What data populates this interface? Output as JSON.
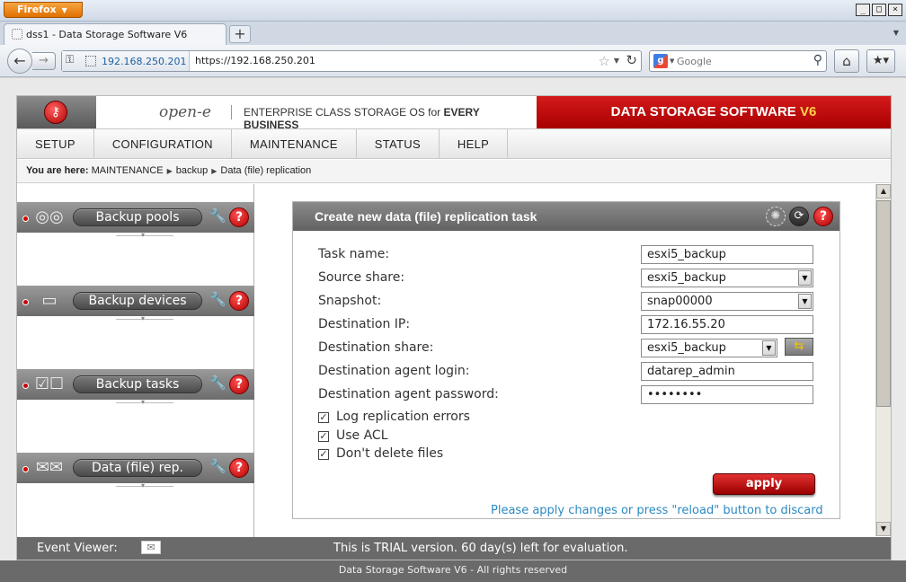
{
  "browser": {
    "app_button": "Firefox",
    "tab_title": "dss1 - Data Storage Software V6",
    "site_identity": "192.168.250.201",
    "url": "https://192.168.250.201",
    "search_placeholder": "Google"
  },
  "header": {
    "logo": "open-e",
    "tagline_pre": "ENTERPRISE CLASS STORAGE OS for ",
    "tagline_bold": "EVERY BUSINESS",
    "product": "DATA STORAGE SOFTWARE ",
    "product_version": "V6"
  },
  "menu": [
    "SETUP",
    "CONFIGURATION",
    "MAINTENANCE",
    "STATUS",
    "HELP"
  ],
  "breadcrumb": {
    "prefix": "You are here:",
    "items": [
      "MAINTENANCE",
      "backup",
      "Data (file) replication"
    ]
  },
  "sidebar": {
    "sections": [
      {
        "label": "Backup pools",
        "icon": "disk-icon"
      },
      {
        "label": "Backup devices",
        "icon": "tape-drive-icon"
      },
      {
        "label": "Backup tasks",
        "icon": "task-list-icon"
      },
      {
        "label": "Data (file) rep.",
        "icon": "replication-icon"
      }
    ]
  },
  "panel": {
    "title": "Create new data (file) replication task",
    "fields": {
      "task_name": {
        "label": "Task name:",
        "value": "esxi5_backup"
      },
      "source_share": {
        "label": "Source share:",
        "value": "esxi5_backup"
      },
      "snapshot": {
        "label": "Snapshot:",
        "value": "snap00000"
      },
      "dest_ip": {
        "label": "Destination IP:",
        "value": "172.16.55.20"
      },
      "dest_share": {
        "label": "Destination share:",
        "value": "esxi5_backup"
      },
      "agent_login": {
        "label": "Destination agent login:",
        "value": "datarep_admin"
      },
      "agent_password": {
        "label": "Destination agent password:",
        "value": "••••••••"
      }
    },
    "checkboxes": [
      {
        "label": "Log replication errors",
        "checked": true
      },
      {
        "label": "Use ACL",
        "checked": true
      },
      {
        "label": "Don't delete files",
        "checked": true
      }
    ],
    "apply_label": "apply",
    "hint": "Please apply changes or press \"reload\" button to discard"
  },
  "status": {
    "event_viewer": "Event Viewer:",
    "trial": "This is TRIAL version. 60 day(s) left for evaluation.",
    "footer": "Data Storage Software V6 - All rights reserved"
  },
  "colors": {
    "brand_red": "#c00000",
    "version_yellow": "#ffd24a",
    "hint_blue": "#2a8ac2",
    "firefox_orange": "#e07000"
  }
}
